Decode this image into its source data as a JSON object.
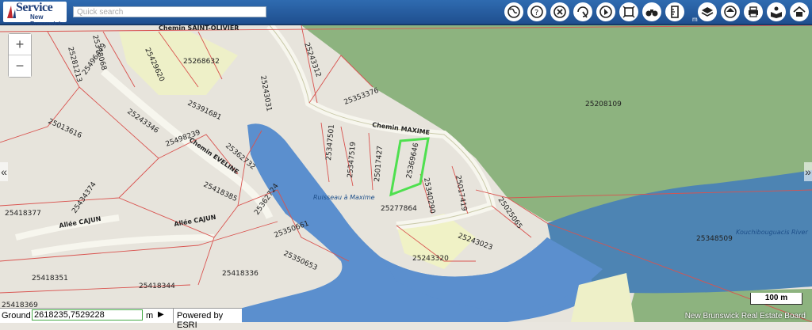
{
  "header": {
    "logo_title": "Service",
    "logo_subtitle": "New Brunswick",
    "search_placeholder": "Quick search",
    "unit_label": "m"
  },
  "toolbar_icons": [
    "globe-icon",
    "help-icon",
    "clear-icon",
    "identify-icon",
    "select-icon",
    "full-extent-icon",
    "binoculars-icon",
    "measure-icon",
    "layers-icon",
    "basemap-icon",
    "print-icon",
    "reader-icon",
    "home-icon"
  ],
  "zoom": {
    "in_label": "+",
    "out_label": "−"
  },
  "nav": {
    "left_label": "«",
    "right_label": "»"
  },
  "map": {
    "parcels": [
      "25281213",
      "25378068",
      "25496449",
      "25429620",
      "25268632",
      "25243312",
      "25243031",
      "25353376",
      "25208109",
      "25013616",
      "25243346",
      "25391681",
      "25498239",
      "25362732",
      "25418385",
      "25347501",
      "25347519",
      "25017427",
      "25369646",
      "25340290",
      "25017419",
      "25025065",
      "25418377",
      "25434374",
      "25362724",
      "25350661",
      "25350653",
      "25277864",
      "25243320",
      "25243023",
      "25348509",
      "25418351",
      "25418344",
      "25418336",
      "25418369"
    ],
    "roads": [
      "Chemin MAXIME",
      "Chemin EVELINE",
      "Allée CAJUN",
      "Allée CAJUN",
      "Chemin SAINT-OLIVIER"
    ],
    "water": [
      "Ruisseau à Maxime",
      "Kouchibouguacis River"
    ],
    "highlight_parcel": "25369646",
    "colors": {
      "water": "#5b8fce",
      "forest": "#8db37f",
      "parcel_line": "#d9534f",
      "highlight": "#4fe04f"
    }
  },
  "ground": {
    "label": "Ground",
    "coords": "2618235,7529228",
    "unit": "m",
    "go_label": "▶",
    "powered_by": "Powered by ESRI"
  },
  "scale": {
    "label": "100 m"
  },
  "credit": "New Brunswick Real Estate Board"
}
